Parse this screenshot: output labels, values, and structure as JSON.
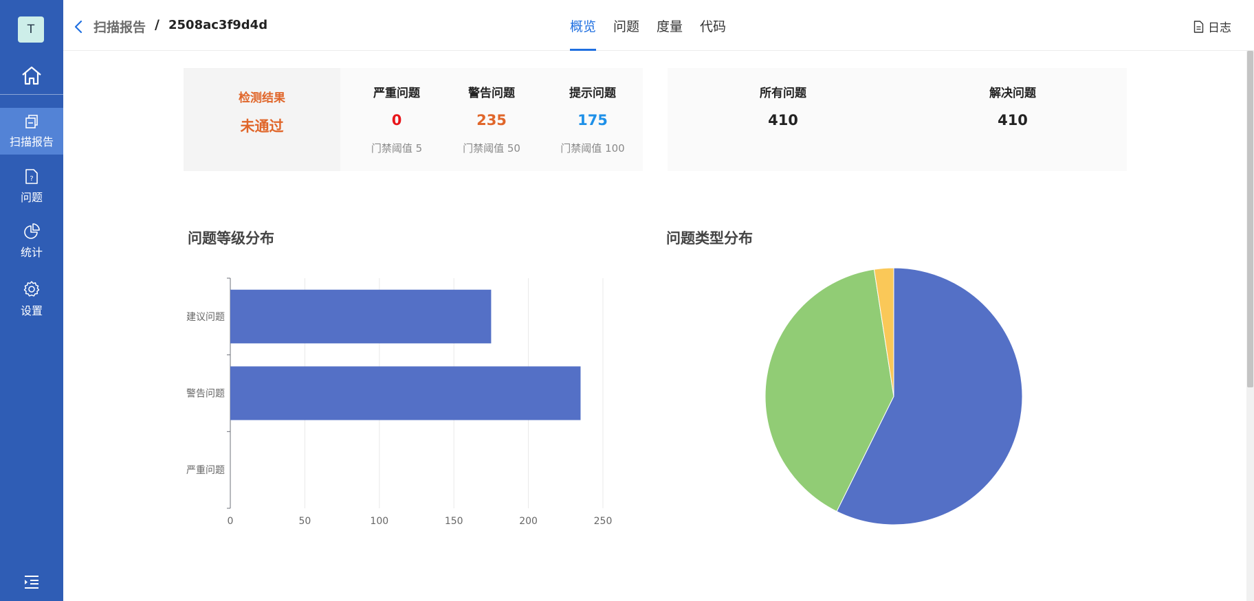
{
  "sidebar": {
    "avatar_text": "T",
    "items": [
      {
        "label": "扫描报告",
        "icon": "report-icon",
        "active": true
      },
      {
        "label": "问题",
        "icon": "issue-file-icon",
        "active": false
      },
      {
        "label": "统计",
        "icon": "pie-chart-icon",
        "active": false
      },
      {
        "label": "设置",
        "icon": "gear-icon",
        "active": false
      }
    ]
  },
  "header": {
    "breadcrumb_parent": "扫描报告",
    "breadcrumb_sep": "/",
    "breadcrumb_current": "2508ac3f9d4d",
    "tabs": [
      {
        "label": "概览",
        "active": true
      },
      {
        "label": "问题",
        "active": false
      },
      {
        "label": "度量",
        "active": false
      },
      {
        "label": "代码",
        "active": false
      }
    ],
    "log_label": "日志"
  },
  "summary": {
    "result_label": "检测结果",
    "result_value": "未通过",
    "result_color": "#e0662a",
    "counts": [
      {
        "label": "严重问题",
        "value": "0",
        "threshold": "门禁阈值 5",
        "color": "#e8161b"
      },
      {
        "label": "警告问题",
        "value": "235",
        "threshold": "门禁阈值 50",
        "color": "#e0662a"
      },
      {
        "label": "提示问题",
        "value": "175",
        "threshold": "门禁阈值 100",
        "color": "#1e90e8"
      }
    ],
    "totals": [
      {
        "label": "所有问题",
        "value": "410"
      },
      {
        "label": "解决问题",
        "value": "410"
      }
    ]
  },
  "level_chart_title": "问题等级分布",
  "type_chart_title": "问题类型分布",
  "chart_data": [
    {
      "type": "bar",
      "orientation": "horizontal",
      "categories": [
        "建议问题",
        "警告问题",
        "严重问题"
      ],
      "values": [
        175,
        235,
        0
      ],
      "xlim": [
        0,
        250
      ],
      "xticks": [
        0,
        50,
        100,
        150,
        200,
        250
      ],
      "color": "#5470c6",
      "grid": true
    },
    {
      "type": "pie",
      "values": [
        235,
        165,
        10
      ],
      "colors": [
        "#5470c6",
        "#91cc75",
        "#fac858"
      ]
    }
  ]
}
